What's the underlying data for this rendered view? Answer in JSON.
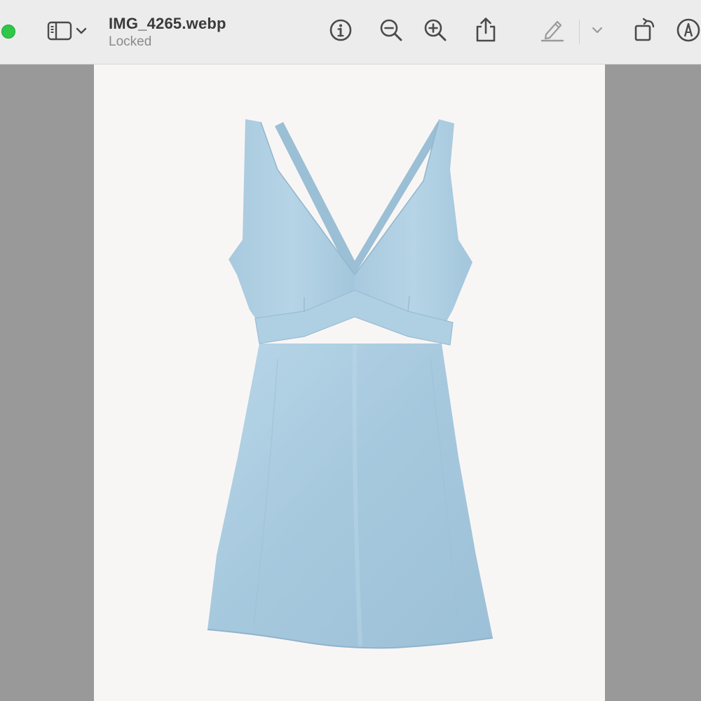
{
  "window": {
    "title": "IMG_4265.webp",
    "subtitle": "Locked"
  },
  "toolbar": {
    "icons": {
      "zoom_button": "green-zoom-traffic-light",
      "sidebar": "sidebar-icon",
      "sidebar_menu": "chevron-down-icon",
      "info": "info-icon",
      "zoom_out": "zoom-out-icon",
      "zoom_in": "zoom-in-icon",
      "share": "share-icon",
      "highlight": "pen-icon",
      "highlight_menu": "chevron-down-icon",
      "rotate": "rotate-icon",
      "markup": "markup-icon"
    }
  },
  "colors": {
    "toolbar_bg": "#ececec",
    "viewer_bg": "#999999",
    "image_bg": "#f8f6f5",
    "dress": "#a9cbe0",
    "traffic_green": "#2ec748"
  },
  "image": {
    "subject": "light blue satin v-neck mini dress"
  }
}
